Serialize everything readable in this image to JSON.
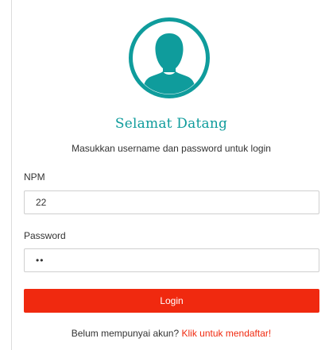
{
  "colors": {
    "accent": "#0f9c9c",
    "primary_button": "#f0290f",
    "link": "#f0290f"
  },
  "avatar": {
    "icon": "user-silhouette-icon"
  },
  "login": {
    "welcome": "Selamat Datang",
    "subtitle": "Masukkan username dan password untuk login",
    "npm_label": "NPM",
    "npm_value": "22",
    "password_label": "Password",
    "password_value": "••",
    "button_label": "Login"
  },
  "register": {
    "text": "Belum mempunyai akun?",
    "link_label": "Klik untuk mendaftar!"
  }
}
